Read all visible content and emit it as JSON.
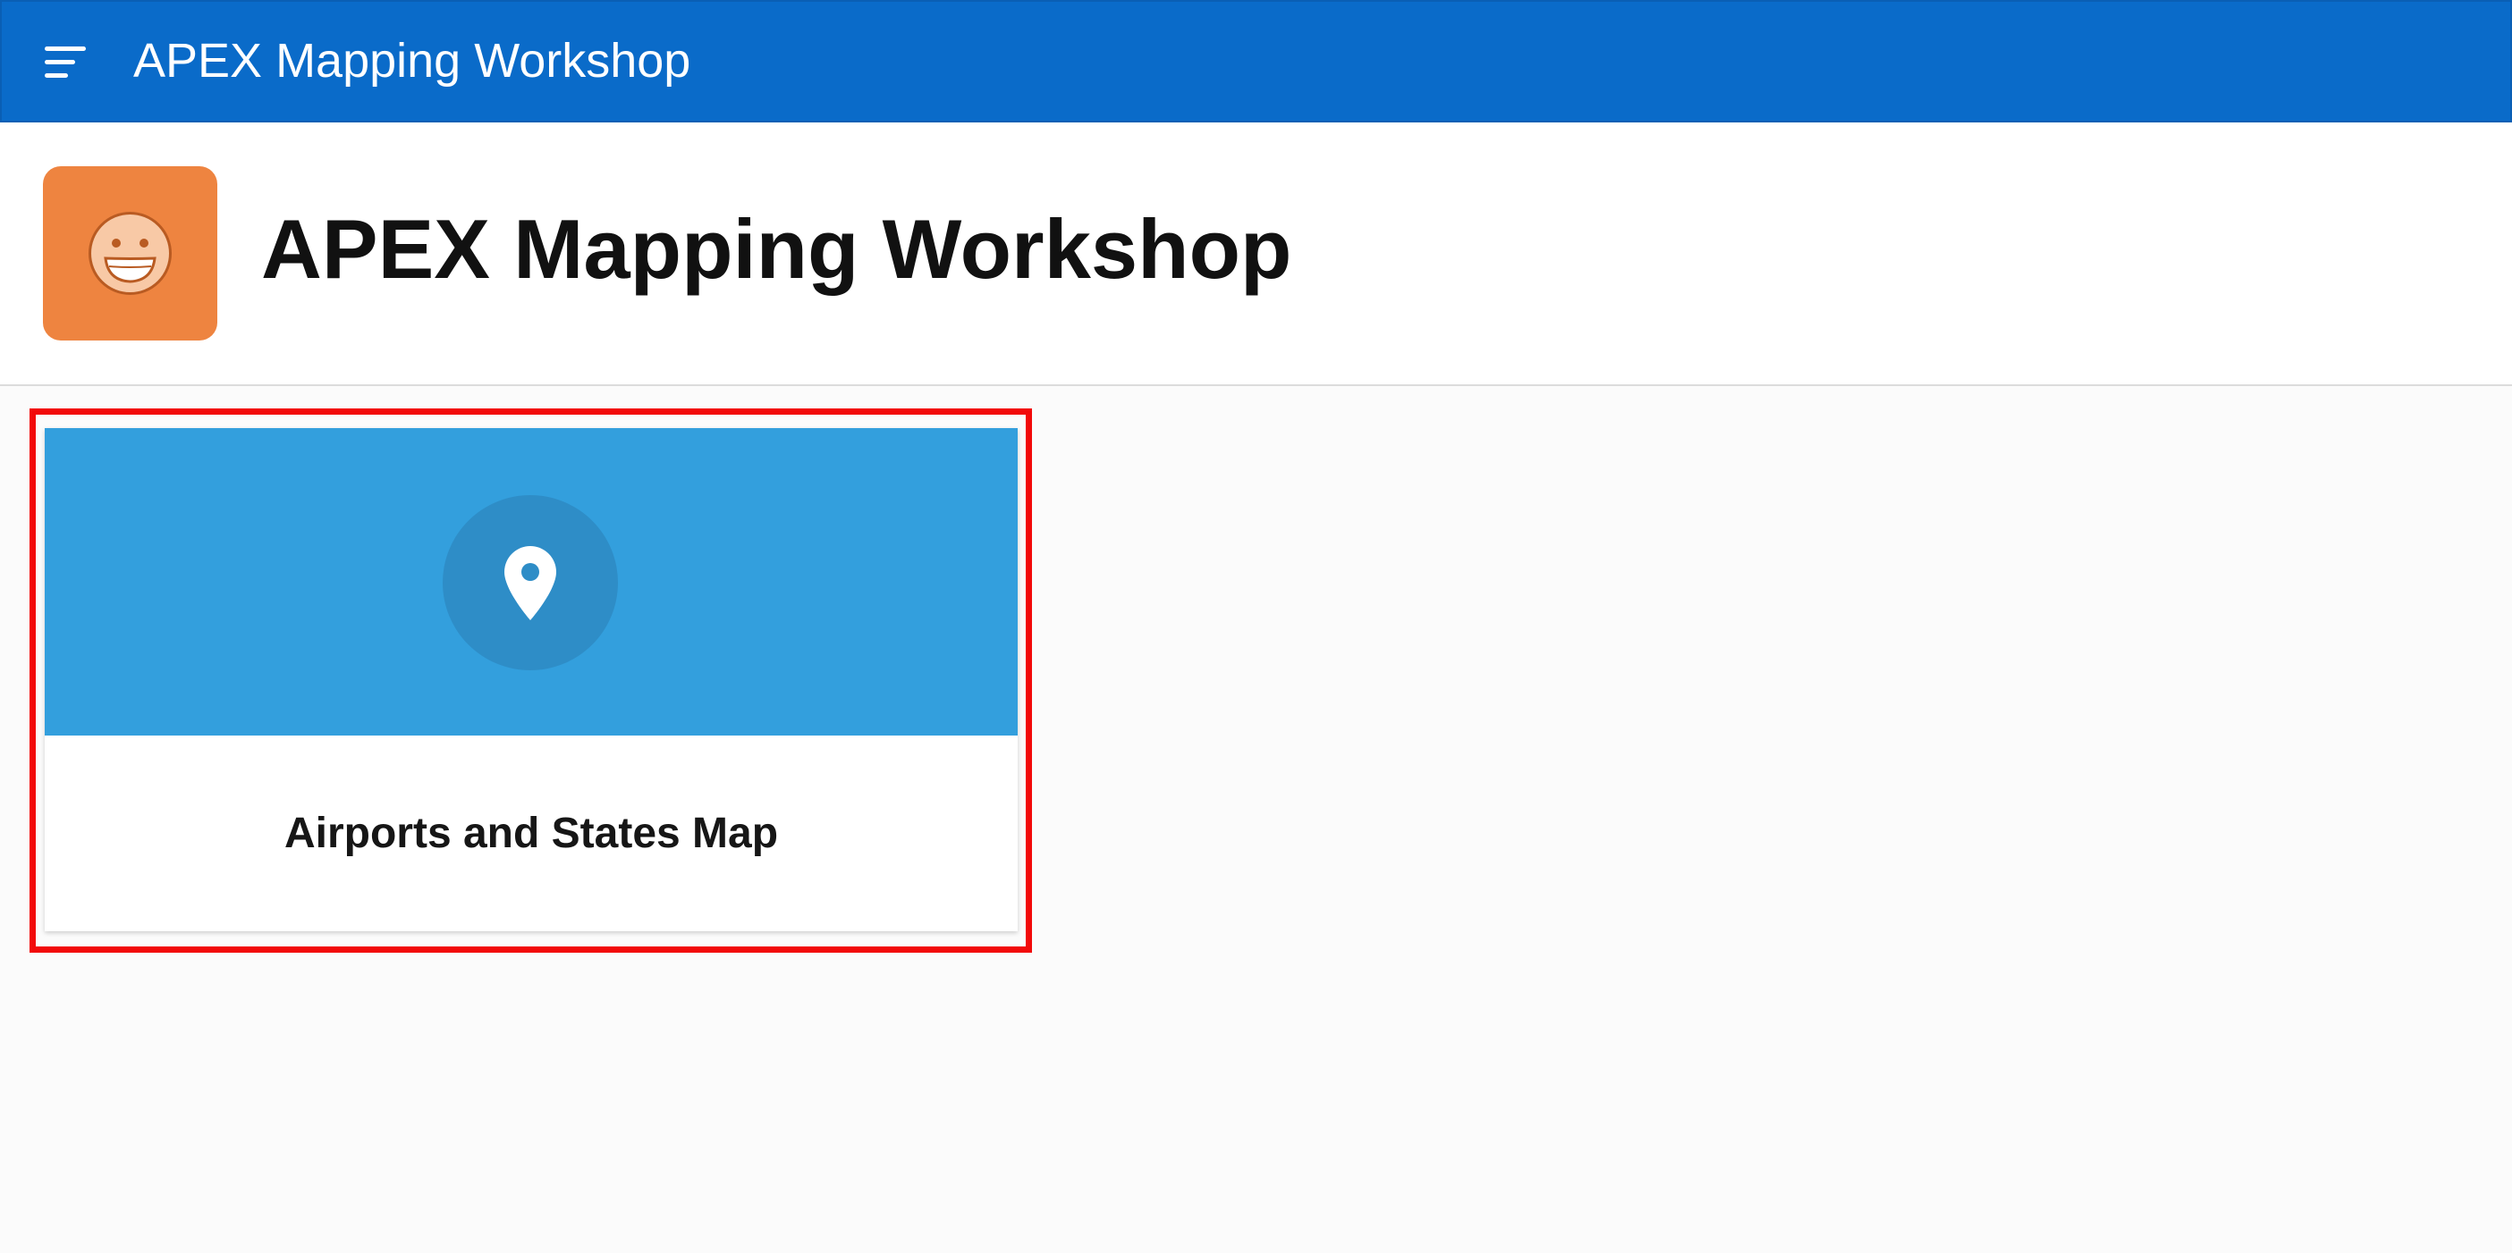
{
  "header": {
    "title": "APEX Mapping Workshop",
    "menu_icon": "hamburger-menu-icon",
    "color": "#0a6bc9"
  },
  "hero": {
    "title": "APEX Mapping Workshop",
    "app_icon": "smiley-face-icon",
    "app_icon_color": "#ee8440"
  },
  "cards": [
    {
      "title": "Airports and States Map",
      "icon": "map-pin-icon",
      "banner_color": "#339fdd",
      "highlighted": true,
      "highlight_color": "#f20a0a"
    }
  ]
}
